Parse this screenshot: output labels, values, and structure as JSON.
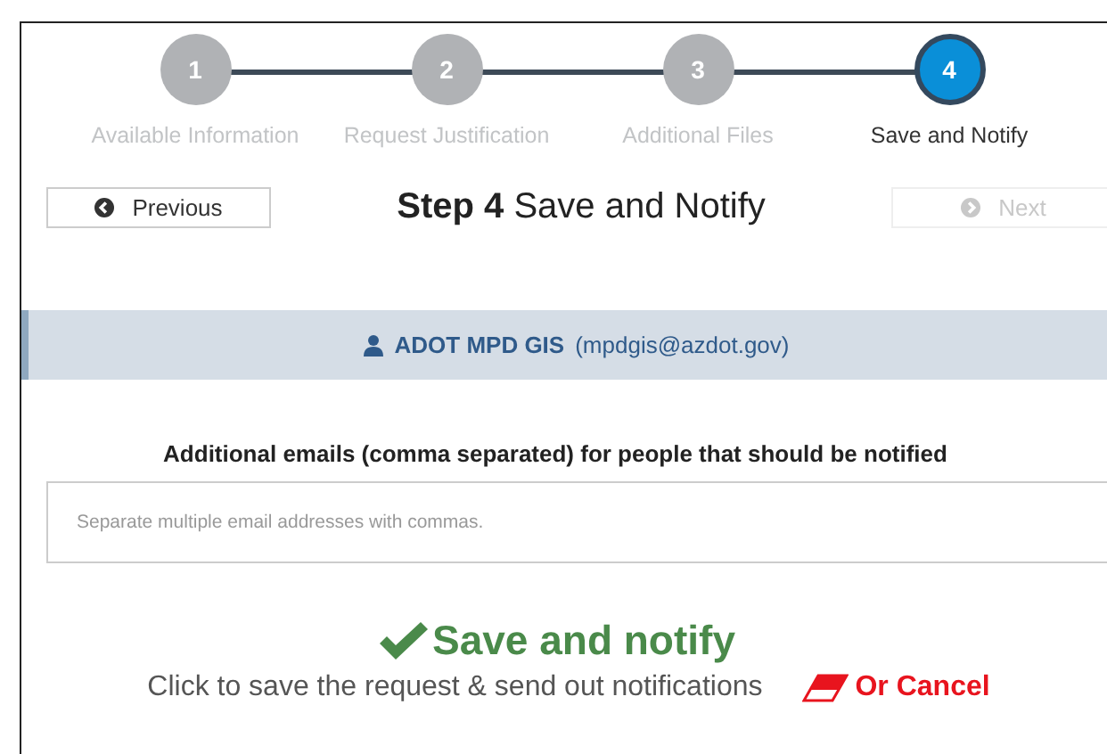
{
  "steps": [
    {
      "number": "1",
      "label": "Available Information",
      "selected": false
    },
    {
      "number": "2",
      "label": "Request Justification",
      "selected": false
    },
    {
      "number": "3",
      "label": "Additional Files",
      "selected": false
    },
    {
      "number": "4",
      "label": "Save and Notify",
      "selected": true
    }
  ],
  "navigation": {
    "previous": {
      "label": "Previous",
      "disabled": false
    },
    "title": "**Step 4** Save and Notify",
    "next": {
      "label": "Next",
      "disabled": true
    }
  },
  "user": {
    "name": "ADOT MPD GIS",
    "email": "(mpdgis@azdot.gov)"
  },
  "emails": {
    "label": "Additional emails (comma separated) for people that should be notified",
    "placeholder": "Separate multiple email addresses with commas."
  },
  "save": {
    "label": "Save and notify",
    "description": "Click to save the request & send out notifications",
    "cancel": "Or Cancel"
  }
}
